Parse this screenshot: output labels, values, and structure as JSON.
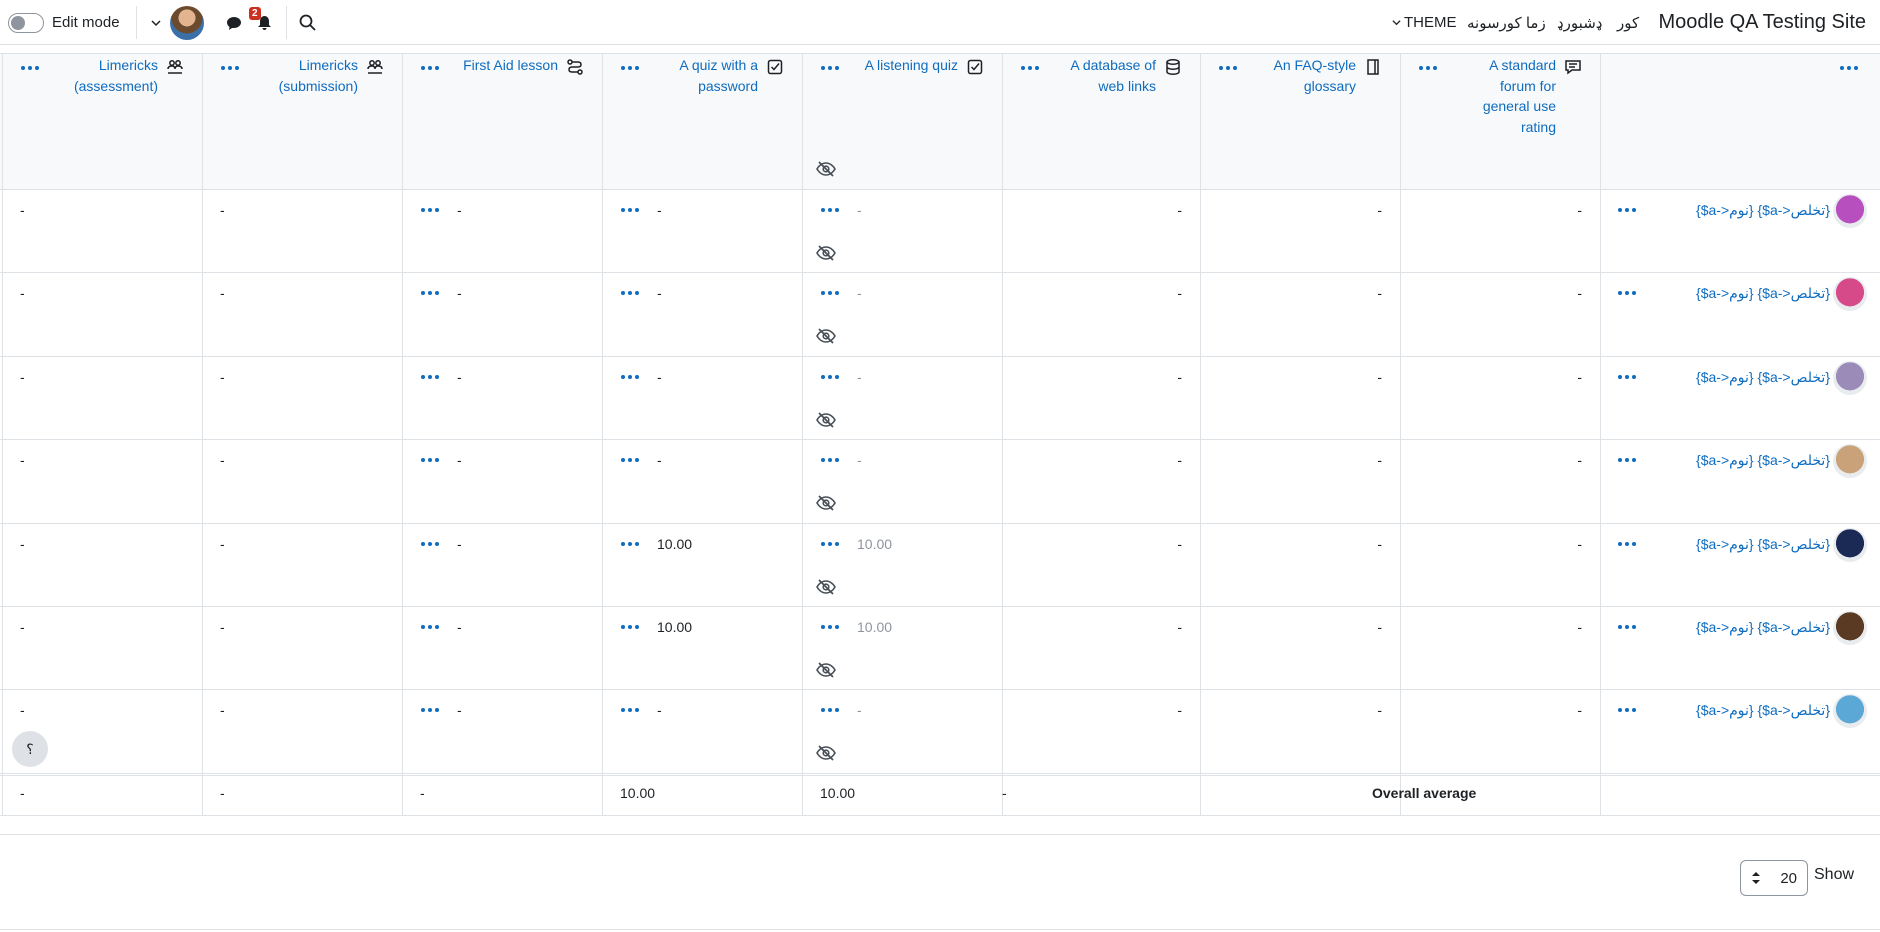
{
  "topbar": {
    "site_name": "Moodle QA Testing Site",
    "nav": [
      "کور",
      "ډشبورډ",
      "زما کورسونه",
      "THEME"
    ],
    "edit_mode_label": "Edit mode",
    "notification_count": "2",
    "icons": [
      "search-icon",
      "bell-icon",
      "message-icon",
      "chevron-down-icon"
    ]
  },
  "columns": [
    {
      "title_lines": [
        "A standard",
        "forum for",
        "general use",
        "rating"
      ],
      "icon": "forum-icon",
      "hidden": false
    },
    {
      "title_lines": [
        "An FAQ-style",
        "glossary"
      ],
      "icon": "glossary-icon",
      "hidden": false
    },
    {
      "title_lines": [
        "A database of",
        "web links"
      ],
      "icon": "database-icon",
      "hidden": false
    },
    {
      "title_lines": [
        "A listening quiz"
      ],
      "icon": "quiz-icon",
      "hidden": true
    },
    {
      "title_lines": [
        "A quiz with a",
        "password"
      ],
      "icon": "quiz-icon",
      "hidden": false
    },
    {
      "title_lines": [
        "First Aid lesson"
      ],
      "icon": "lesson-icon",
      "hidden": false
    },
    {
      "title_lines": [
        "Limericks",
        "(submission)"
      ],
      "icon": "workshop-icon",
      "hidden": false
    },
    {
      "title_lines": [
        "Limericks",
        "(assessment)"
      ],
      "icon": "workshop-icon",
      "hidden": false
    }
  ],
  "students": [
    {
      "name": "{$a->نوم} {$a->تخلص}",
      "avatar_color": "#b84fbf",
      "grades": [
        "-",
        "-",
        "-",
        "-",
        "-",
        "-",
        "-",
        "-"
      ]
    },
    {
      "name": "{$a->نوم} {$a->تخلص}",
      "avatar_color": "#d64a8a",
      "grades": [
        "-",
        "-",
        "-",
        "-",
        "-",
        "-",
        "-",
        "-"
      ]
    },
    {
      "name": "{$a->نوم} {$a->تخلص}",
      "avatar_color": "#9a8bb8",
      "grades": [
        "-",
        "-",
        "-",
        "-",
        "-",
        "-",
        "-",
        "-"
      ]
    },
    {
      "name": "{$a->نوم} {$a->تخلص}",
      "avatar_color": "#c9a27a",
      "grades": [
        "-",
        "-",
        "-",
        "-",
        "-",
        "-",
        "-",
        "-"
      ]
    },
    {
      "name": "{$a->نوم} {$a->تخلص}",
      "avatar_color": "#1b2a55",
      "grades": [
        "-",
        "-",
        "-",
        "10.00",
        "10.00",
        "-",
        "-",
        "-"
      ]
    },
    {
      "name": "{$a->نوم} {$a->تخلص}",
      "avatar_color": "#5a3a22",
      "grades": [
        "-",
        "-",
        "-",
        "10.00",
        "10.00",
        "-",
        "-",
        "-"
      ]
    },
    {
      "name": "{$a->نوم} {$a->تخلص}",
      "avatar_color": "#5ba8d6",
      "grades": [
        "-",
        "-",
        "-",
        "-",
        "-",
        "-",
        "-",
        "-"
      ]
    }
  ],
  "overall": {
    "label": "Overall average",
    "values": [
      "",
      "-",
      "10.00",
      "10.00",
      "-",
      "-",
      "-"
    ]
  },
  "footer": {
    "per_page_value": "20",
    "show_label": "Show"
  },
  "help_glyph": "؟"
}
